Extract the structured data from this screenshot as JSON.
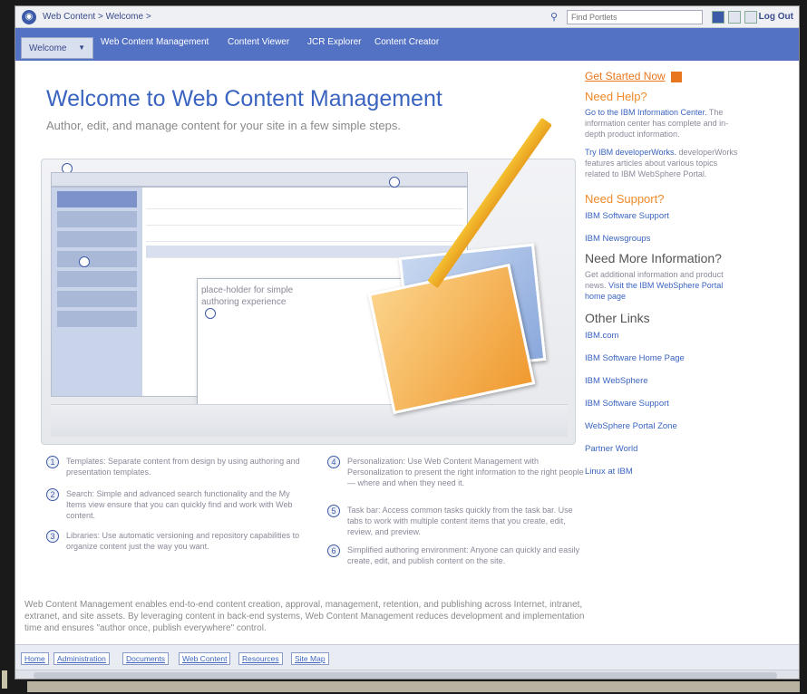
{
  "topbar": {
    "breadcrumb": "Web Content > Welcome >",
    "search_placeholder": "Find Portlets",
    "logout": "Log Out"
  },
  "nav": {
    "current": "Welcome",
    "tabs": [
      "Web Content Management",
      "Content Viewer",
      "JCR Explorer",
      "Content Creator"
    ]
  },
  "main": {
    "title": "Welcome to Web Content Management",
    "subtitle": "Author, edit, and manage content for your site in a few simple steps.",
    "placeholder_text": "place-holder for simple authoring experience",
    "features": [
      {
        "num": "1",
        "text": "Templates: Separate content from design by using authoring and presentation templates."
      },
      {
        "num": "2",
        "text": "Search: Simple and advanced search functionality and the My Items view ensure that you can quickly find and work with Web content."
      },
      {
        "num": "3",
        "text": "Libraries: Use automatic versioning and repository capabilities to organize content just the way you want."
      },
      {
        "num": "4",
        "text": "Personalization: Use Web Content Management with Personalization to present the right information to the right people — where and when they need it."
      },
      {
        "num": "5",
        "text": "Task bar: Access common tasks quickly from the task bar. Use tabs to work with multiple content items that you create, edit, review, and preview."
      },
      {
        "num": "6",
        "text": "Simplified authoring environment: Anyone can quickly and easily create, edit, and publish content on the site."
      }
    ],
    "summary": "Web Content Management enables end-to-end content creation, approval, management, retention, and publishing across Internet, intranet, extranet, and site assets. By leveraging content in back-end systems, Web Content Management reduces development and implementation time and ensures \"author once, publish everywhere\" control."
  },
  "sidebar": {
    "cta": "Get Started Now",
    "need_help_heading": "Need Help?",
    "info_center_link": "Go to the IBM Information Center.",
    "info_center_text": "The information center has complete and in-depth product information.",
    "dw_link": "Try IBM developerWorks.",
    "dw_text": "developerWorks features articles about various topics related to IBM WebSphere Portal.",
    "support_heading": "Need Support?",
    "support_links": [
      "IBM Software Support",
      "IBM Newsgroups"
    ],
    "more_info_heading": "Need More Information?",
    "more_info_text": "Get additional information and product news.",
    "more_info_link": "Visit the IBM WebSphere Portal home page",
    "other_links_heading": "Other Links",
    "other_links": [
      "IBM.com",
      "IBM Software Home Page",
      "IBM WebSphere",
      "IBM Software Support",
      "WebSphere Portal Zone",
      "Partner World",
      "Linux at IBM"
    ]
  },
  "footer": {
    "links": [
      "Home",
      "Administration",
      "Documents",
      "Web Content",
      "Resources",
      "Site Map"
    ]
  },
  "colors": {
    "nav_blue": "#5472c4",
    "link_blue": "#3a64c0",
    "accent_orange": "#e8761e"
  }
}
